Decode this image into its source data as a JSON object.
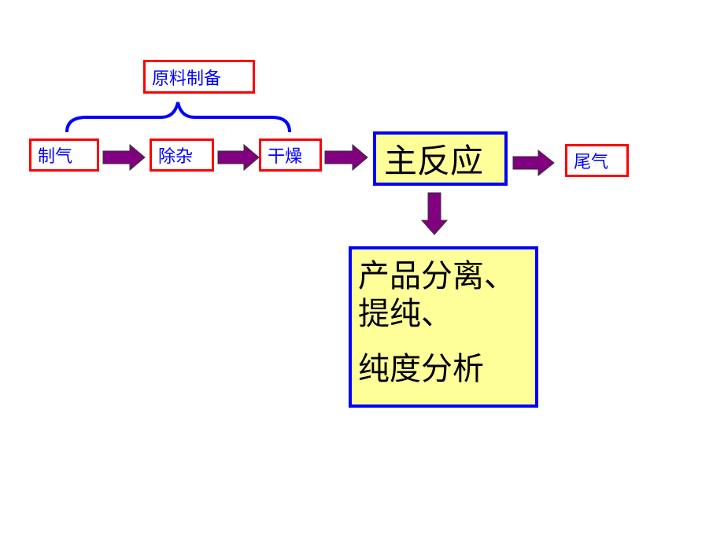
{
  "diagram": {
    "group_label": "原料制备",
    "steps": [
      "制气",
      "除杂",
      "干燥"
    ],
    "main_reaction": "主反应",
    "tail_gas": "尾气",
    "product_lines": [
      "产品分离、",
      "提纯、",
      "纯度分析"
    ],
    "colors": {
      "step_border": "#ff0000",
      "step_text": "#0000ff",
      "main_border": "#0000ff",
      "main_fill": "#ffff99",
      "arrow_fill": "#800080",
      "brace": "#0000ff"
    }
  }
}
